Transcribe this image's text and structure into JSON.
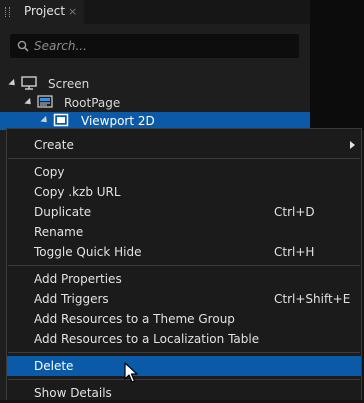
{
  "panel": {
    "tab_title": "Project",
    "tab_close": "×",
    "search_placeholder": "Search..."
  },
  "tree": [
    {
      "label": "Screen",
      "icon": "monitor-icon"
    },
    {
      "label": "RootPage",
      "icon": "page-icon"
    },
    {
      "label": "Viewport 2D",
      "icon": "viewport-icon",
      "selected": true
    }
  ],
  "menu": {
    "create": "Create",
    "copy": "Copy",
    "copy_kzb_url": "Copy .kzb URL",
    "duplicate": "Duplicate",
    "duplicate_shortcut": "Ctrl+D",
    "rename": "Rename",
    "toggle_quick_hide": "Toggle Quick Hide",
    "toggle_quick_hide_shortcut": "Ctrl+H",
    "add_properties": "Add Properties",
    "add_triggers": "Add Triggers",
    "add_triggers_shortcut": "Ctrl+Shift+E",
    "add_resources_theme": "Add Resources to a Theme Group",
    "add_resources_localization": "Add Resources to a Localization Table",
    "delete": "Delete",
    "show_details": "Show Details"
  },
  "colors": {
    "selection": "#0a5aa8",
    "panel_bg": "#1e1e1e",
    "menu_bg": "#1b1b1b"
  }
}
